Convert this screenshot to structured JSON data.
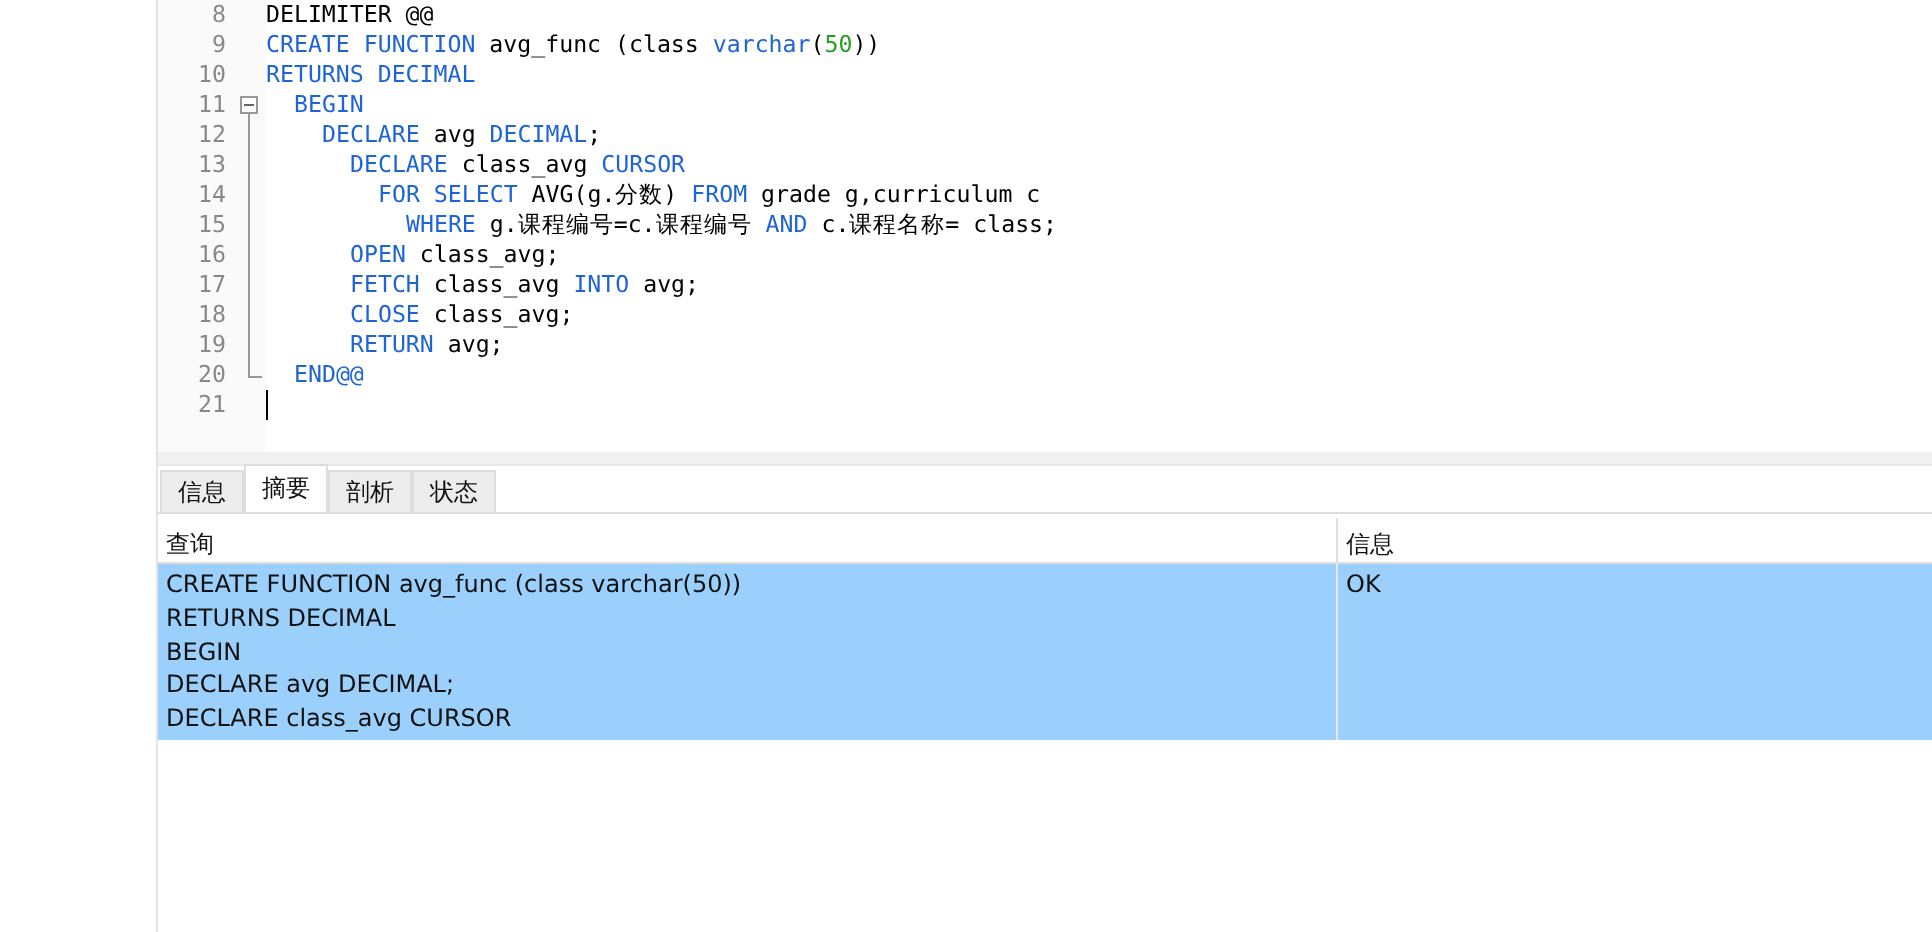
{
  "editor": {
    "lines": [
      {
        "number": "8",
        "tokens": [
          {
            "kind": "plain",
            "text": "DELIMITER @@"
          }
        ]
      },
      {
        "number": "9",
        "tokens": [
          {
            "kind": "keyword",
            "text": "CREATE FUNCTION"
          },
          {
            "kind": "plain",
            "text": " avg_func (class "
          },
          {
            "kind": "keyword",
            "text": "varchar"
          },
          {
            "kind": "plain",
            "text": "("
          },
          {
            "kind": "number",
            "text": "50"
          },
          {
            "kind": "plain",
            "text": "))"
          }
        ]
      },
      {
        "number": "10",
        "tokens": [
          {
            "kind": "keyword",
            "text": "RETURNS DECIMAL"
          }
        ],
        "children": [
          {
            "number": "11",
            "expanded": true,
            "tokens": [
              {
                "kind": "keyword",
                "text": "BEGIN"
              }
            ],
            "children": [
              {
                "number": "12",
                "tokens": [
                  {
                    "kind": "keyword",
                    "text": "DECLARE"
                  },
                  {
                    "kind": "plain",
                    "text": " avg "
                  },
                  {
                    "kind": "keyword",
                    "text": "DECIMAL"
                  },
                  {
                    "kind": "plain",
                    "text": ";"
                  }
                ],
                "children": [
                  {
                    "number": "13",
                    "tokens": [
                      {
                        "kind": "keyword",
                        "text": "DECLARE"
                      },
                      {
                        "kind": "plain",
                        "text": " class_avg "
                      },
                      {
                        "kind": "keyword",
                        "text": "CURSOR"
                      }
                    ],
                    "children": [
                      {
                        "number": "14",
                        "tokens": [
                          {
                            "kind": "keyword",
                            "text": "FOR SELECT"
                          },
                          {
                            "kind": "plain",
                            "text": " AVG(g.分数) "
                          },
                          {
                            "kind": "keyword",
                            "text": "FROM"
                          },
                          {
                            "kind": "plain",
                            "text": " grade g,curriculum c"
                          }
                        ],
                        "children": [
                          {
                            "number": "15",
                            "tokens": [
                              {
                                "kind": "keyword",
                                "text": "WHERE"
                              },
                              {
                                "kind": "plain",
                                "text": " g.课程编号=c.课程编号 "
                              },
                              {
                                "kind": "keyword",
                                "text": "AND"
                              },
                              {
                                "kind": "plain",
                                "text": " c.课程名称= class;"
                              }
                            ]
                          }
                        ]
                      }
                    ]
                  },
                  {
                    "number": "16",
                    "tokens": [
                      {
                        "kind": "keyword",
                        "text": "OPEN"
                      },
                      {
                        "kind": "plain",
                        "text": " class_avg;"
                      }
                    ]
                  },
                  {
                    "number": "17",
                    "tokens": [
                      {
                        "kind": "keyword",
                        "text": "FETCH"
                      },
                      {
                        "kind": "plain",
                        "text": " class_avg "
                      },
                      {
                        "kind": "keyword",
                        "text": "INTO"
                      },
                      {
                        "kind": "plain",
                        "text": " avg;"
                      }
                    ]
                  },
                  {
                    "number": "18",
                    "tokens": [
                      {
                        "kind": "keyword",
                        "text": "CLOSE"
                      },
                      {
                        "kind": "plain",
                        "text": " class_avg;"
                      }
                    ]
                  },
                  {
                    "number": "19",
                    "tokens": [
                      {
                        "kind": "keyword",
                        "text": "RETURN"
                      },
                      {
                        "kind": "plain",
                        "text": " avg;"
                      }
                    ]
                  }
                ]
              }
            ]
          },
          {
            "number": "20",
            "tokens": [
              {
                "kind": "keyword",
                "text": "END@@"
              }
            ]
          }
        ]
      },
      {
        "number": "21",
        "cursor": true
      }
    ]
  },
  "tabs": [
    {
      "label": "信息",
      "selected": false
    },
    {
      "label": "摘要",
      "selected": true
    },
    {
      "label": "剖析",
      "selected": false
    },
    {
      "label": "状态",
      "selected": false
    }
  ],
  "results": {
    "columns": [
      "查询",
      "信息"
    ],
    "rows": [
      {
        "selected": true,
        "query_lines": [
          "CREATE FUNCTION avg_func (class varchar(50))",
          "RETURNS DECIMAL",
          "BEGIN",
          "DECLARE avg DECIMAL;",
          "DECLARE class_avg CURSOR"
        ],
        "message": "OK"
      }
    ]
  }
}
